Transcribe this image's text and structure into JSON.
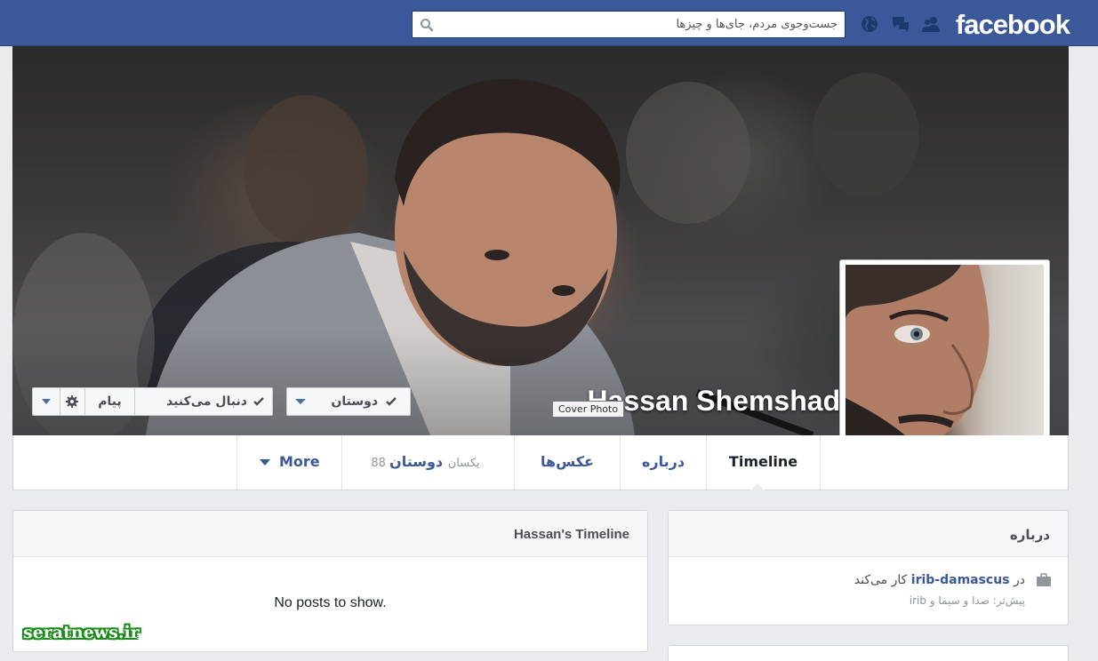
{
  "header": {
    "logo": "facebook",
    "search_placeholder": "جست‌وجوی مردم، جای‌ها و چیزها",
    "icons": [
      "friend-requests-icon",
      "messages-icon",
      "notifications-globe-icon",
      "search-icon"
    ],
    "brand_color": "#3b5998"
  },
  "profile": {
    "name": "Hassan Shemshadi",
    "cover_tooltip": "Cover Photo"
  },
  "actions": {
    "friends_label": "دوستان",
    "following_label": "دنبال می‌کنید",
    "message_label": "پیام"
  },
  "tabs": {
    "timeline": "Timeline",
    "about": "درباره",
    "photos": "عکس‌ها",
    "friends": "دوستان",
    "friends_count": "88 یکسان",
    "more": "More"
  },
  "timeline_panel": {
    "title": "Hassan's Timeline",
    "empty": "No posts to show."
  },
  "about_panel": {
    "title": "درباره",
    "work_prefix": "در",
    "work_place": "irib-damascus",
    "work_suffix": "کار می‌کند",
    "previous": "پیش‌تر: صدا و سیما و irib"
  },
  "watermark": "seratnews.ir"
}
